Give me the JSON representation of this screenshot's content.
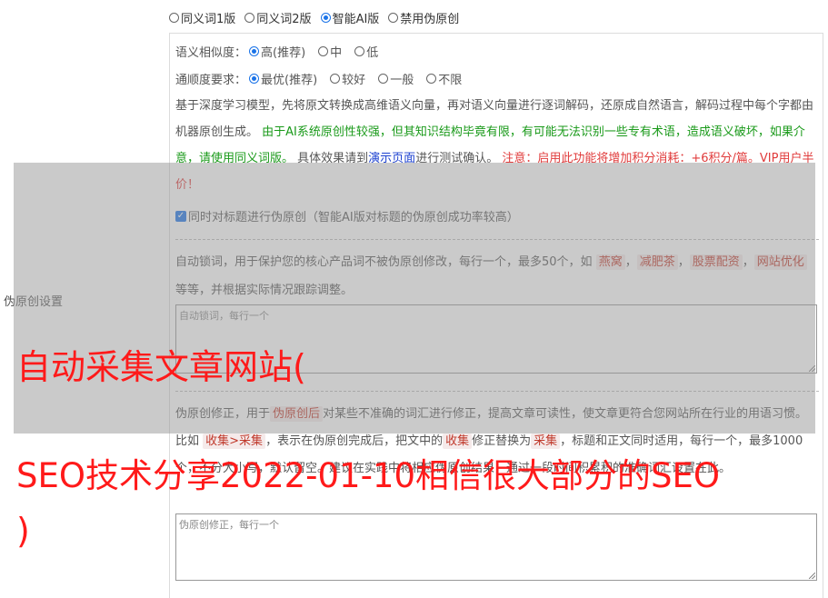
{
  "modes": [
    {
      "label": "同义词1版",
      "checked": false
    },
    {
      "label": "同义词2版",
      "checked": false
    },
    {
      "label": "智能AI版",
      "checked": true
    },
    {
      "label": "禁用伪原创",
      "checked": false
    }
  ],
  "left_label": "伪原创设置",
  "similarity": {
    "label": "语义相似度：",
    "options": [
      {
        "label": "高(推荐)",
        "checked": true
      },
      {
        "label": "中",
        "checked": false
      },
      {
        "label": "低",
        "checked": false
      }
    ]
  },
  "fluency": {
    "label": "通顺度要求：",
    "options": [
      {
        "label": "最优(推荐)",
        "checked": true
      },
      {
        "label": "较好",
        "checked": false
      },
      {
        "label": "一般",
        "checked": false
      },
      {
        "label": "不限",
        "checked": false
      }
    ]
  },
  "description": {
    "part1": "基于深度学习模型，先将原文转换成高维语义向量，再对语义向量进行逐词解码，还原成自然语言，解码过程中每个字都由机器原创生成。",
    "part2": "由于AI系统原创性较强，但其知识结构毕竟有限，有可能无法识别一些专有术语，造成语义破坏，如果介意，请使用同义词版。",
    "part3": "具体效果请到",
    "link": "演示页面",
    "part4": "进行测试确认。",
    "part5": "注意：启用此功能将增加积分消耗：+6积分/篇。VIP用户半价！"
  },
  "title_checkbox": {
    "label": "同时对标题进行伪原创（智能AI版对标题的伪原创成功率较高）",
    "checked": true
  },
  "lock_words": {
    "desc_prefix": "自动锁词，用于保护您的核心产品词不被伪原创修改，每行一个，最多50个，如",
    "examples": [
      "燕窝",
      "减肥茶",
      "股票配资",
      "网站优化"
    ],
    "sep": "，",
    "desc_suffix": "等等，并根据实际情况跟踪调整。",
    "placeholder": "自动锁词，每行一个"
  },
  "correction": {
    "desc1": "伪原创修正，用于",
    "kw1": "伪原创后",
    "desc2": "对某些不准确的词汇进行修正，提高文章可读性，使文章更符合您网站所在行业的用语习惯。比如",
    "kw2": "收集>采集",
    "desc3": "，表示在伪原创完成后，把文中的",
    "kw3": "收集",
    "desc4": "修正替换为",
    "kw4": "采集",
    "desc5": "，标题和正文同时适用，每行一个，最多1000个，不分大小写，默认留空。建议在实践中将相应伪原创结果，通过一段时间积累积的准确词汇设置在此。",
    "placeholder": "伪原创修正，每行一个"
  },
  "overlay_title": {
    "line1": "自动采集文章网站(",
    "line2": "SEO技术分享2022-01-10相信很大部分的SEO",
    "line3": ")"
  },
  "colors": {
    "accent": "#1a73e8",
    "green": "#1a9a1a",
    "blue": "#1a3fd0",
    "red": "#e03b3b",
    "title_red": "#ff1a1a"
  }
}
